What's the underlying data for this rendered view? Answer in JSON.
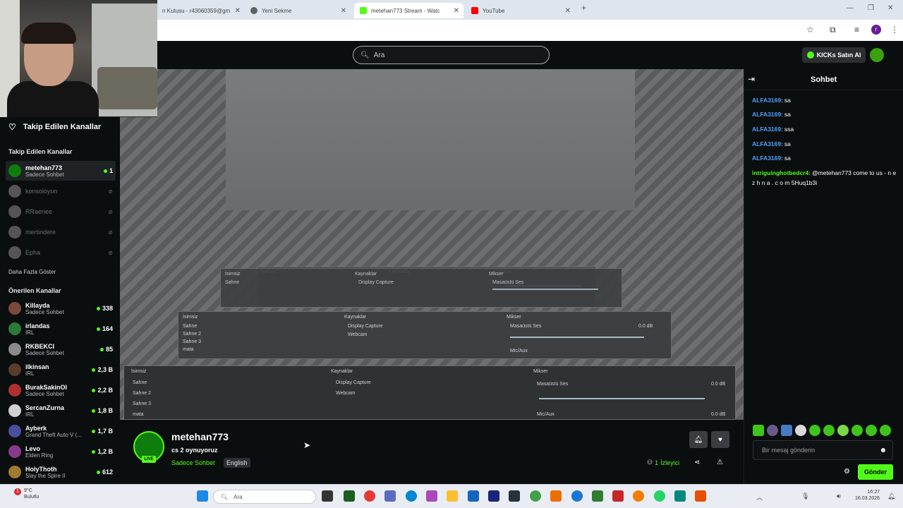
{
  "browser": {
    "tabs": [
      {
        "label": "n Kutusu - r43060359@gm",
        "icon_color": "#c5221f"
      },
      {
        "label": "Yeni Sekme",
        "icon_color": "#5f6368"
      },
      {
        "label": "metehan773 Stream - Watc",
        "icon_color": "#53fc18"
      },
      {
        "label": "YouTube",
        "icon_color": "#ff0000"
      }
    ],
    "new_tab_label": "+",
    "profile_initial": "r"
  },
  "header": {
    "search_placeholder": "Ara",
    "kicks_button": "KICKs Satın Al"
  },
  "sidebar": {
    "heading": "Takip Edilen Kanallar",
    "followed_title": "Takip Edilen Kanallar",
    "followed": [
      {
        "name": "metehan773",
        "sub": "Sadece Sohbet",
        "count": "1",
        "live": true,
        "color": "#0e7d0c"
      },
      {
        "name": "konsoloyun",
        "live": false
      },
      {
        "name": "RRaenee",
        "live": false
      },
      {
        "name": "mertindere",
        "live": false
      },
      {
        "name": "Epha",
        "live": false
      }
    ],
    "show_more": "Daha Fazla Göster",
    "recommended_title": "Önerilen Kanallar",
    "recommended": [
      {
        "name": "Killayda",
        "sub": "Sadece Sohbet",
        "count": "338",
        "color": "#7a4b3a"
      },
      {
        "name": "irlandas",
        "sub": "IRL",
        "count": "164",
        "color": "#2b7a3a"
      },
      {
        "name": "RKBEKCI",
        "sub": "Sadece Sohbet",
        "count": "85",
        "color": "#8a8a8a"
      },
      {
        "name": "ilkinsan",
        "sub": "IRL",
        "count": "2,3 B",
        "color": "#5a3c2c"
      },
      {
        "name": "BurakSakinOl",
        "sub": "Sadece Sohbet",
        "count": "2,2 B",
        "color": "#b03030"
      },
      {
        "name": "SercanZurna",
        "sub": "IRL",
        "count": "1,8 B",
        "color": "#d0d0d0"
      },
      {
        "name": "Ayberk",
        "sub": "Grand Theft Auto V (...",
        "count": "1,7 B",
        "color": "#4a4fa0"
      },
      {
        "name": "Levo",
        "sub": "Elden Ring",
        "count": "1,2 B",
        "color": "#8a3a8a"
      },
      {
        "name": "HolyThoth",
        "sub": "Slay the Spire II",
        "count": "612",
        "color": "#a07a30"
      }
    ]
  },
  "obs": {
    "panels": [
      "İsimsiz",
      "Kaynaklar",
      "Mikser"
    ],
    "scenes": [
      "Sahne",
      "Sahne 2",
      "Sahne 3",
      "mata"
    ],
    "sources": [
      "Display Capture",
      "Webcam"
    ],
    "mixer": [
      "Masaüstü Ses",
      "Mic/Aux"
    ],
    "db": "0.0 dB"
  },
  "stream": {
    "streamer": "metehan773",
    "title": "cs 2 oynuyoruz",
    "category": "Sadece Sohbet",
    "tag": "English",
    "live_badge": "LIVE",
    "viewers": "1",
    "viewers_label": "İzleyici"
  },
  "chat": {
    "title": "Sohbet",
    "messages": [
      {
        "user": "ALFA3169",
        "color": "#4aa3ff",
        "text": ": sa"
      },
      {
        "user": "ALFA3169",
        "color": "#4aa3ff",
        "text": ": sa"
      },
      {
        "user": "ALFA3169",
        "color": "#4aa3ff",
        "text": ": ssa"
      },
      {
        "user": "ALFA3169",
        "color": "#4aa3ff",
        "text": ": sa"
      },
      {
        "user": "ALFA3169",
        "color": "#4aa3ff",
        "text": ": sa"
      },
      {
        "user": "intriguinghotbedcr4",
        "color": "#53fc18",
        "text": ": @metehan773 come to us - n e z h n a . c o m 5Huq1b3i"
      }
    ],
    "input_placeholder": "Bir mesaj gönderin",
    "send_label": "Gönder"
  },
  "taskbar": {
    "weather_temp": "9°C",
    "weather_desc": "Bulutlu",
    "search_label": "Ara",
    "time": "16:27",
    "date": "16.03.2026",
    "notification_badge": "1"
  },
  "colors": {
    "accent": "#53fc18",
    "background": "#0b0e0f"
  }
}
